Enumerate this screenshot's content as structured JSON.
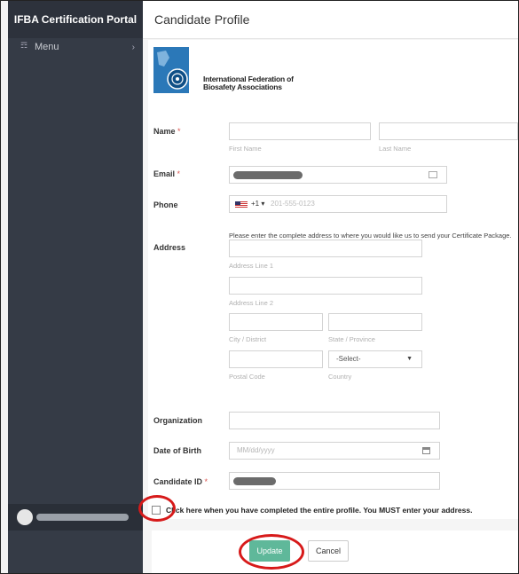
{
  "sidebar": {
    "app_title": "IFBA Certification Portal",
    "menu_label": "Menu",
    "menu_icon": "sitemap-icon",
    "chevron": "›"
  },
  "header": {
    "title": "Candidate Profile"
  },
  "org": {
    "name_line1": "International Federation of",
    "name_line2": "Biosafety Associations"
  },
  "form": {
    "name_label": "Name",
    "required_mark": "*",
    "first_name_hint": "First Name",
    "last_name_hint": "Last Name",
    "email_label": "Email",
    "phone_label": "Phone",
    "phone_country_code": "+1 ▾",
    "phone_placeholder": "201-555-0123",
    "address_info": "Please enter the complete address to where you would like us to send your Certificate Package.",
    "address_label": "Address",
    "address_line1_hint": "Address Line 1",
    "address_line2_hint": "Address Line 2",
    "city_hint": "City / District",
    "state_hint": "State / Province",
    "postal_hint": "Postal Code",
    "country_hint": "Country",
    "country_value": "-Select-",
    "organization_label": "Organization",
    "dob_label": "Date of Birth",
    "dob_placeholder": "MM/dd/yyyy",
    "candidate_id_label": "Candidate ID",
    "confirm_text": "Click here when you have completed the entire profile. You MUST enter your address."
  },
  "footer": {
    "update_label": "Update",
    "cancel_label": "Cancel"
  },
  "colors": {
    "sidebar_bg": "#353b46",
    "update_button": "#5fb89a",
    "required": "#d9534f",
    "annotation_circle": "#d71a1a"
  }
}
